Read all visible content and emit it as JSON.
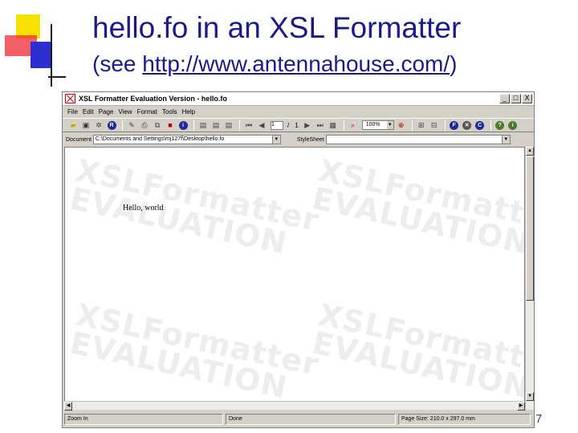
{
  "slide": {
    "title": "hello.fo in an XSL Formatter",
    "subtitle_prefix": "(see ",
    "subtitle_link": "http://www.antennahouse.com/",
    "subtitle_suffix": ")",
    "page_number": "7"
  },
  "window": {
    "title": "XSL Formatter Evaluation Version - hello.fo",
    "controls": {
      "minimize": "_",
      "maximize": "□",
      "close": "X"
    }
  },
  "menu": [
    "File",
    "Edit",
    "Page",
    "View",
    "Format",
    "Tools",
    "Help"
  ],
  "toolbar": {
    "page_input": "1",
    "page_sep": "/",
    "page_total": "1",
    "zoom": "100%"
  },
  "docbar": {
    "document_label": "Document",
    "document_path": "C:\\Documents and Settings\\mj127f\\Desktop\\hello.fo",
    "stylesheet_label": "StyleSheet",
    "stylesheet_value": ""
  },
  "document": {
    "content": "Hello, world",
    "watermark": "XSLFormatter\nEVALUATION"
  },
  "status": {
    "zoom": "Zoom In",
    "state": "Done",
    "page_size": "Page Size: 210.0 x 297.0 mm"
  },
  "colors": {
    "title_blue": "#1a1a8a",
    "window_gray": "#d4d0c8",
    "watermark": "#ededed"
  }
}
